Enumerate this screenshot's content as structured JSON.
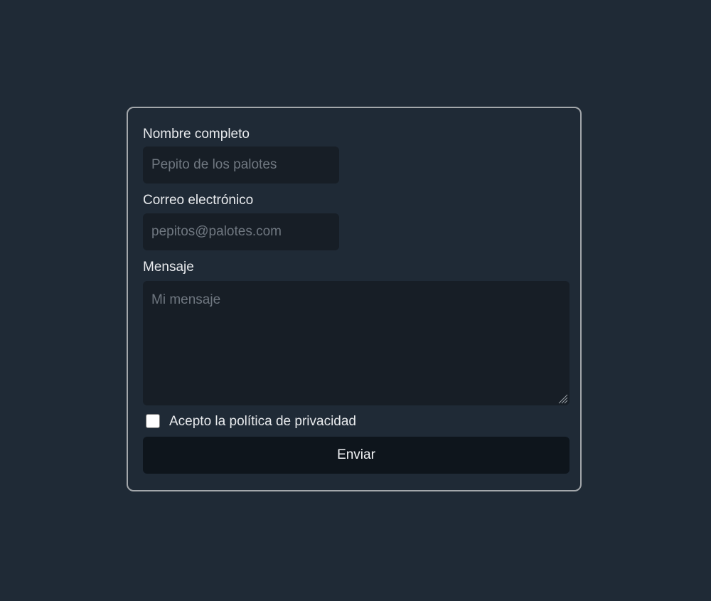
{
  "form": {
    "name_label": "Nombre completo",
    "name_placeholder": "Pepito de los palotes",
    "email_label": "Correo electrónico",
    "email_placeholder": "pepitos@palotes.com",
    "message_label": "Mensaje",
    "message_placeholder": "Mi mensaje",
    "privacy_label": "Acepto la política de privacidad",
    "privacy_checked": false,
    "submit_label": "Enviar"
  },
  "colors": {
    "background": "#1f2a36",
    "card_border": "#a3a7ab",
    "field_background": "#171e26",
    "button_background": "#0e151c"
  }
}
